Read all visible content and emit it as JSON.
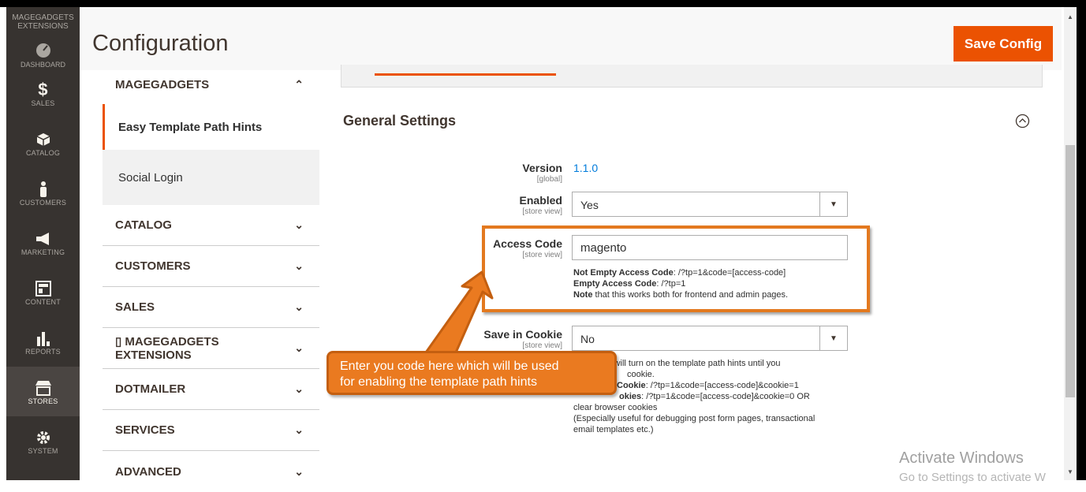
{
  "adminnav": {
    "brand_line1": "MAGEGADGETS",
    "brand_line2": "EXTENSIONS",
    "items": [
      {
        "label": "DASHBOARD",
        "icon": "dashboard-icon"
      },
      {
        "label": "SALES",
        "icon": "dollar-icon"
      },
      {
        "label": "CATALOG",
        "icon": "box-icon"
      },
      {
        "label": "CUSTOMERS",
        "icon": "person-icon"
      },
      {
        "label": "MARKETING",
        "icon": "megaphone-icon"
      },
      {
        "label": "CONTENT",
        "icon": "layout-icon"
      },
      {
        "label": "REPORTS",
        "icon": "bar-chart-icon"
      },
      {
        "label": "STORES",
        "icon": "store-icon"
      },
      {
        "label": "SYSTEM",
        "icon": "gear-icon"
      }
    ],
    "active": "STORES"
  },
  "header": {
    "title": "Configuration",
    "save_label": "Save Config"
  },
  "tabs": {
    "magegadgets_label": "MAGEGADGETS",
    "sub_items": [
      "Easy Template Path Hints",
      "Social Login"
    ],
    "groups": [
      "CATALOG",
      "CUSTOMERS",
      "SALES",
      "▯ MAGEGADGETS EXTENSIONS",
      "DOTMAILER",
      "SERVICES",
      "ADVANCED"
    ]
  },
  "section": {
    "title": "General Settings",
    "fields": {
      "version": {
        "label": "Version",
        "scope": "[global]",
        "value": "1.1.0"
      },
      "enabled": {
        "label": "Enabled",
        "scope": "[store view]",
        "value": "Yes"
      },
      "access_code": {
        "label": "Access Code",
        "scope": "[store view]",
        "value": "magento",
        "note1_bold": "Not Empty Access Code",
        "note1": ": /?tp=1&code=[access-code]",
        "note2_bold": "Empty Access Code",
        "note2": ": /?tp=1",
        "note3_bold": "Note",
        "note3": " that this works both for frontend and admin pages."
      },
      "save_cookie": {
        "label": "Save in Cookie",
        "scope": "[store view]",
        "value": "No",
        "note_line1": "it will turn on the template path hints until you",
        "note_line2": "cookie.",
        "note_line3_bold": "Cookie",
        "note_line3": ": /?tp=1&code=[access-code]&cookie=1",
        "note_line4_bold": "okies",
        "note_line4": ": /?tp=1&code=[access-code]&cookie=0 OR",
        "note_line5": "clear browser cookies",
        "note_line6": "(Especially useful for debugging post form pages, transactional",
        "note_line7": "email templates etc.)"
      }
    }
  },
  "callout": {
    "line1": "Enter you code here which will be used",
    "line2": "for enabling the template path hints"
  },
  "watermark": {
    "line1": "Activate Windows",
    "line2": "Go to Settings to activate W"
  },
  "colors": {
    "accent": "#eb5202",
    "nav_bg": "#373330",
    "callout": "#ea7a20"
  }
}
